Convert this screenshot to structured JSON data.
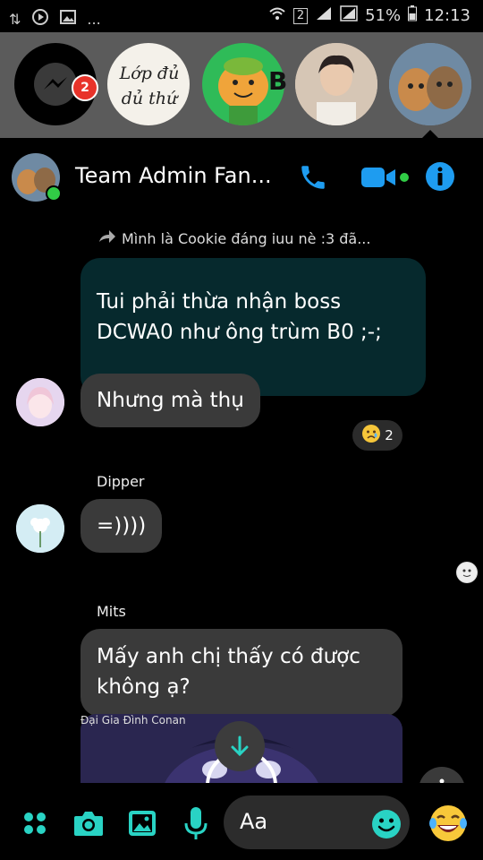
{
  "status_bar": {
    "left_icons": [
      "transfer-icon",
      "play-icon",
      "image-icon",
      "more-dots"
    ],
    "more": "...",
    "sim": "2",
    "battery": "51%",
    "time": "12:13"
  },
  "chat_heads": {
    "messenger_badge": "2",
    "group_name_lines": [
      "Lớp đủ",
      "dủ thứ"
    ],
    "partial_name": "B ậ"
  },
  "header": {
    "title": "Team Admin Fan..."
  },
  "messages": {
    "forwarded_label": "Mình là Cookie đáng iuu nè :3 đã...",
    "forwarded_text": "Tui phải thừa nhận boss DCWA0 như ông trùm B0 ;-;",
    "msg1": "Nhưng mà thụ",
    "reaction_count": "2",
    "sender2": "Dipper",
    "msg2": "=))))",
    "sender3": "Mits",
    "msg3": "Mấy anh chị thấy có được không ạ?",
    "preview_label": "Đại Gia Đình Conan"
  },
  "composer": {
    "placeholder": "Aa"
  },
  "colors": {
    "accent": "#29d3c4",
    "call_blue": "#1e9cf0",
    "badge_red": "#e8332a",
    "online_green": "#31cc46"
  }
}
